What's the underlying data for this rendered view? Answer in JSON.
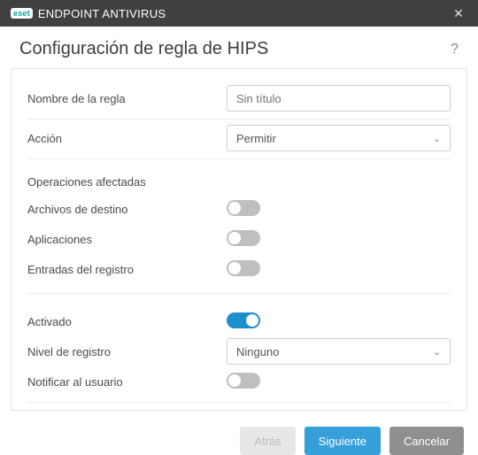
{
  "titlebar": {
    "logo_text": "eset",
    "product_name": "ENDPOINT ANTIVIRUS"
  },
  "header": {
    "title": "Configuración de regla de HIPS"
  },
  "form": {
    "rule_name_label": "Nombre de la regla",
    "rule_name_placeholder": "Sin título",
    "rule_name_value": "",
    "action_label": "Acción",
    "action_value": "Permitir",
    "affected_ops_title": "Operaciones afectadas",
    "target_files_label": "Archivos de destino",
    "target_files_on": false,
    "applications_label": "Aplicaciones",
    "applications_on": false,
    "registry_entries_label": "Entradas del registro",
    "registry_entries_on": false,
    "activated_label": "Activado",
    "activated_on": true,
    "log_level_label": "Nivel de registro",
    "log_level_value": "Ninguno",
    "notify_user_label": "Notificar al usuario",
    "notify_user_on": false
  },
  "footer": {
    "back": "Atrás",
    "next": "Siguiente",
    "cancel": "Cancelar"
  }
}
